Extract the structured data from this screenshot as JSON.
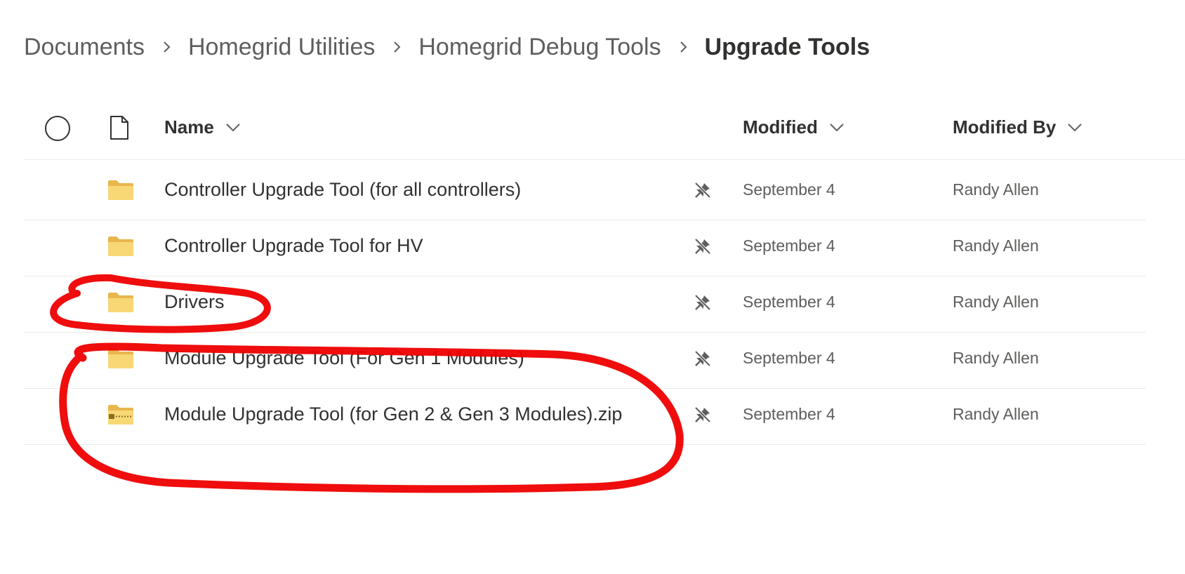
{
  "breadcrumb": {
    "items": [
      "Documents",
      "Homegrid Utilities",
      "Homegrid Debug Tools"
    ],
    "current": "Upgrade Tools"
  },
  "columns": {
    "name": "Name",
    "modified": "Modified",
    "modified_by": "Modified By"
  },
  "rows": [
    {
      "name": "Controller Upgrade Tool (for all controllers)",
      "type": "folder",
      "modified": "September 4",
      "modified_by": "Randy Allen"
    },
    {
      "name": "Controller Upgrade Tool for HV",
      "type": "folder",
      "modified": "September 4",
      "modified_by": "Randy Allen"
    },
    {
      "name": "Drivers",
      "type": "folder",
      "modified": "September 4",
      "modified_by": "Randy Allen"
    },
    {
      "name": "Module Upgrade Tool (For Gen 1 Modules)",
      "type": "folder",
      "modified": "September 4",
      "modified_by": "Randy Allen"
    },
    {
      "name": "Module Upgrade Tool (for Gen 2 & Gen 3 Modules).zip",
      "type": "zip-folder",
      "modified": "September 4",
      "modified_by": "Randy Allen"
    }
  ],
  "icons": {
    "select_all": "circle-icon",
    "file_type": "document-icon",
    "folder": "folder-icon",
    "zip_folder": "zip-folder-icon",
    "sync": "pin-off-icon",
    "chevron": "chevron-down-icon",
    "separator": "chevron-right-icon"
  },
  "colors": {
    "folder": "#f8d775",
    "folder_back": "#e9b64b",
    "annotation": "#ee0000"
  }
}
